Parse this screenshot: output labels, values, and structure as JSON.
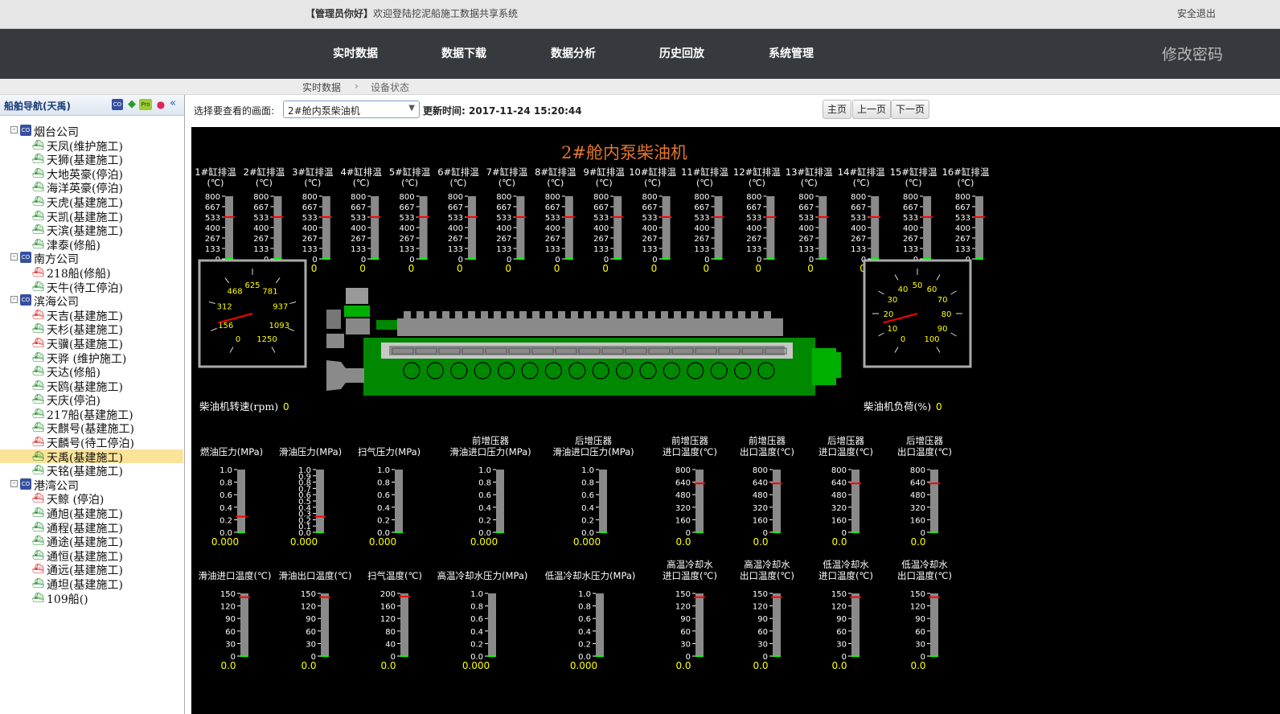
{
  "header": {
    "user_label": "【管理员你好】",
    "welcome": "欢迎登陆挖泥船施工数据共享系统",
    "logout": "安全退出"
  },
  "nav": {
    "items": [
      "实时数据",
      "数据下载",
      "数据分析",
      "历史回放",
      "系统管理"
    ],
    "change_password": "修改密码"
  },
  "breadcrumb": [
    "实时数据",
    "设备状态"
  ],
  "sidebar": {
    "title": "船舶导航(天禹)",
    "header_icons": [
      "co-icon",
      "leaf-icon",
      "pro-icon",
      "pin-icon",
      "collapse-icon"
    ],
    "tree": [
      {
        "type": "company",
        "label": "烟台公司",
        "toggle": "-"
      },
      {
        "type": "ship",
        "label": "天凤(维护施工)",
        "color": "green"
      },
      {
        "type": "ship",
        "label": "天狮(基建施工)",
        "color": "green"
      },
      {
        "type": "ship",
        "label": "大地英豪(停泊)",
        "color": "green"
      },
      {
        "type": "ship",
        "label": "海洋英豪(停泊)",
        "color": "green"
      },
      {
        "type": "ship",
        "label": "天虎(基建施工)",
        "color": "green"
      },
      {
        "type": "ship",
        "label": "天凯(基建施工)",
        "color": "green"
      },
      {
        "type": "ship",
        "label": "天滨(基建施工)",
        "color": "green"
      },
      {
        "type": "ship",
        "label": "津泰(修船)",
        "color": "green"
      },
      {
        "type": "company",
        "label": "南方公司",
        "toggle": "-"
      },
      {
        "type": "ship",
        "label": "218船(修船)",
        "color": "red"
      },
      {
        "type": "ship",
        "label": "天牛(待工停泊)",
        "color": "green"
      },
      {
        "type": "company",
        "label": "滨海公司",
        "toggle": "-"
      },
      {
        "type": "ship",
        "label": "天吉(基建施工)",
        "color": "red"
      },
      {
        "type": "ship",
        "label": "天杉(基建施工)",
        "color": "green"
      },
      {
        "type": "ship",
        "label": "天骥(基建施工)",
        "color": "red"
      },
      {
        "type": "ship",
        "label": "天骅 (维护施工)",
        "color": "green"
      },
      {
        "type": "ship",
        "label": "天达(修船)",
        "color": "green"
      },
      {
        "type": "ship",
        "label": "天鸥(基建施工)",
        "color": "green"
      },
      {
        "type": "ship",
        "label": "天庆(停泊)",
        "color": "green"
      },
      {
        "type": "ship",
        "label": "217船(基建施工)",
        "color": "green"
      },
      {
        "type": "ship",
        "label": "天麒号(基建施工)",
        "color": "green"
      },
      {
        "type": "ship",
        "label": "天麟号(待工停泊)",
        "color": "red"
      },
      {
        "type": "ship",
        "label": "天禹(基建施工)",
        "color": "green",
        "selected": true
      },
      {
        "type": "ship",
        "label": "天铭(基建施工)",
        "color": "green"
      },
      {
        "type": "company",
        "label": "港湾公司",
        "toggle": "-"
      },
      {
        "type": "ship",
        "label": "天鲸 (停泊)",
        "color": "red"
      },
      {
        "type": "ship",
        "label": "通旭(基建施工)",
        "color": "green"
      },
      {
        "type": "ship",
        "label": "通程(基建施工)",
        "color": "green"
      },
      {
        "type": "ship",
        "label": "通途(基建施工)",
        "color": "green"
      },
      {
        "type": "ship",
        "label": "通恒(基建施工)",
        "color": "green"
      },
      {
        "type": "ship",
        "label": "通远(基建施工)",
        "color": "red"
      },
      {
        "type": "ship",
        "label": "通坦(基建施工)",
        "color": "green"
      },
      {
        "type": "ship",
        "label": "109船()",
        "color": "green"
      }
    ]
  },
  "toolbar": {
    "select_label": "选择要查看的画面:",
    "select_value": "2#舱内泵柴油机",
    "update_label": "更新时间:",
    "update_time": "2017-11-24 15:20:44",
    "btn_home": "主页",
    "btn_prev": "上一页",
    "btn_next": "下一页"
  },
  "panel": {
    "title": "2#舱内泵柴油机",
    "cyl_unit": "(℃)",
    "cylinders": [
      "1#缸排温",
      "2#缸排温",
      "3#缸排温",
      "4#缸排温",
      "5#缸排温",
      "6#缸排温",
      "7#缸排温",
      "8#缸排温",
      "9#缸排温",
      "10#缸排温",
      "11#缸排温",
      "12#缸排温",
      "13#缸排温",
      "14#缸排温",
      "15#缸排温",
      "16#缸排温"
    ],
    "cyl_scale": [
      "800",
      "667",
      "533",
      "400",
      "267",
      "133",
      "0"
    ],
    "cyl_value": "0",
    "cyl_mark_level": 0.667,
    "rpm_gauge": {
      "label": "柴油机转速(rpm)",
      "value": "0",
      "ticks": [
        "0",
        "156",
        "312",
        "468",
        "625",
        "781",
        "937",
        "1093",
        "1250"
      ]
    },
    "load_gauge": {
      "label": "柴油机负荷(%)",
      "value": "0",
      "ticks": [
        "0",
        "10",
        "20",
        "30",
        "40",
        "50",
        "60",
        "70",
        "80",
        "90",
        "100"
      ]
    },
    "row1": [
      {
        "label": [
          "",
          "燃油压力(MPa)"
        ],
        "scale": [
          "1.0",
          "0.8",
          "0.6",
          "0.4",
          "0.2",
          "0.0"
        ],
        "value": "0.000",
        "mark": 0.25
      },
      {
        "label": [
          "",
          "滑油压力(MPa)"
        ],
        "scale": [
          "1.0",
          "0.9",
          "0.8",
          "0.7",
          "0.6",
          "0.5",
          "0.4",
          "0.3",
          "0.2",
          "0.1",
          "0.0"
        ],
        "value": "0.000",
        "mark": 0.25
      },
      {
        "label": [
          "",
          "扫气压力(MPa)"
        ],
        "scale": [
          "1.0",
          "0.8",
          "0.6",
          "0.4",
          "0.2",
          "0.0"
        ],
        "value": "0.000",
        "mark": null
      },
      {
        "label": [
          "前增压器",
          "滑油进口压力(MPa)"
        ],
        "scale": [
          "1.0",
          "0.8",
          "0.6",
          "0.4",
          "0.2",
          "0.0"
        ],
        "value": "0.000",
        "mark": null
      },
      {
        "label": [
          "后增压器",
          "滑油进口压力(MPa)"
        ],
        "scale": [
          "1.0",
          "0.8",
          "0.6",
          "0.4",
          "0.2",
          "0.0"
        ],
        "value": "0.000",
        "mark": null
      },
      {
        "label": [
          "前增压器",
          "进口温度(℃)"
        ],
        "scale": [
          "800",
          "640",
          "480",
          "320",
          "160",
          "0"
        ],
        "value": "0.0",
        "mark": 0.78
      },
      {
        "label": [
          "前增压器",
          "出口温度(℃)"
        ],
        "scale": [
          "800",
          "640",
          "480",
          "320",
          "160",
          "0"
        ],
        "value": "0.0",
        "mark": 0.78
      },
      {
        "label": [
          "后增压器",
          "进口温度(℃)"
        ],
        "scale": [
          "800",
          "640",
          "480",
          "320",
          "160",
          "0"
        ],
        "value": "0.0",
        "mark": 0.78
      },
      {
        "label": [
          "后增压器",
          "出口温度(℃)"
        ],
        "scale": [
          "800",
          "640",
          "480",
          "320",
          "160",
          "0"
        ],
        "value": "0.0",
        "mark": 0.78
      }
    ],
    "row2": [
      {
        "label": [
          "",
          "滑油进口温度(℃)"
        ],
        "scale": [
          "150",
          "120",
          "90",
          "60",
          "30",
          "0"
        ],
        "value": "0.0",
        "mark": 0.94
      },
      {
        "label": [
          "",
          "滑油出口温度(℃)"
        ],
        "scale": [
          "150",
          "120",
          "90",
          "60",
          "30",
          "0"
        ],
        "value": "0.0",
        "mark": 0.94
      },
      {
        "label": [
          "",
          "扫气温度(℃)"
        ],
        "scale": [
          "200",
          "160",
          "120",
          "80",
          "40",
          "0"
        ],
        "value": "0.0",
        "mark": 0.95
      },
      {
        "label": [
          "",
          "高温冷却水压力(MPa)"
        ],
        "scale": [
          "1.0",
          "0.8",
          "0.6",
          "0.4",
          "0.2",
          "0.0"
        ],
        "value": "0.000",
        "mark": null
      },
      {
        "label": [
          "",
          "低温冷却水压力(MPa)"
        ],
        "scale": [
          "1.0",
          "0.8",
          "0.6",
          "0.4",
          "0.2",
          "0.0"
        ],
        "value": "0.000",
        "mark": null
      },
      {
        "label": [
          "高温冷却水",
          "进口温度(℃)"
        ],
        "scale": [
          "150",
          "120",
          "90",
          "60",
          "30",
          "0"
        ],
        "value": "0.0",
        "mark": 0.94
      },
      {
        "label": [
          "高温冷却水",
          "出口温度(℃)"
        ],
        "scale": [
          "150",
          "120",
          "90",
          "60",
          "30",
          "0"
        ],
        "value": "0.0",
        "mark": 0.94
      },
      {
        "label": [
          "低温冷却水",
          "进口温度(℃)"
        ],
        "scale": [
          "150",
          "120",
          "90",
          "60",
          "30",
          "0"
        ],
        "value": "0.0",
        "mark": 0.94
      },
      {
        "label": [
          "低温冷却水",
          "出口温度(℃)"
        ],
        "scale": [
          "150",
          "120",
          "90",
          "60",
          "30",
          "0"
        ],
        "value": "0.0",
        "mark": 0.94
      }
    ]
  },
  "colors": {
    "nav_bg": "#36393d",
    "panel_bg": "#000000",
    "title": "#e2772d",
    "value": "#ffff00",
    "engine": "#008800",
    "tube": "#8a8a8a",
    "mark": "#ff0000",
    "needle": "#ff0000"
  }
}
